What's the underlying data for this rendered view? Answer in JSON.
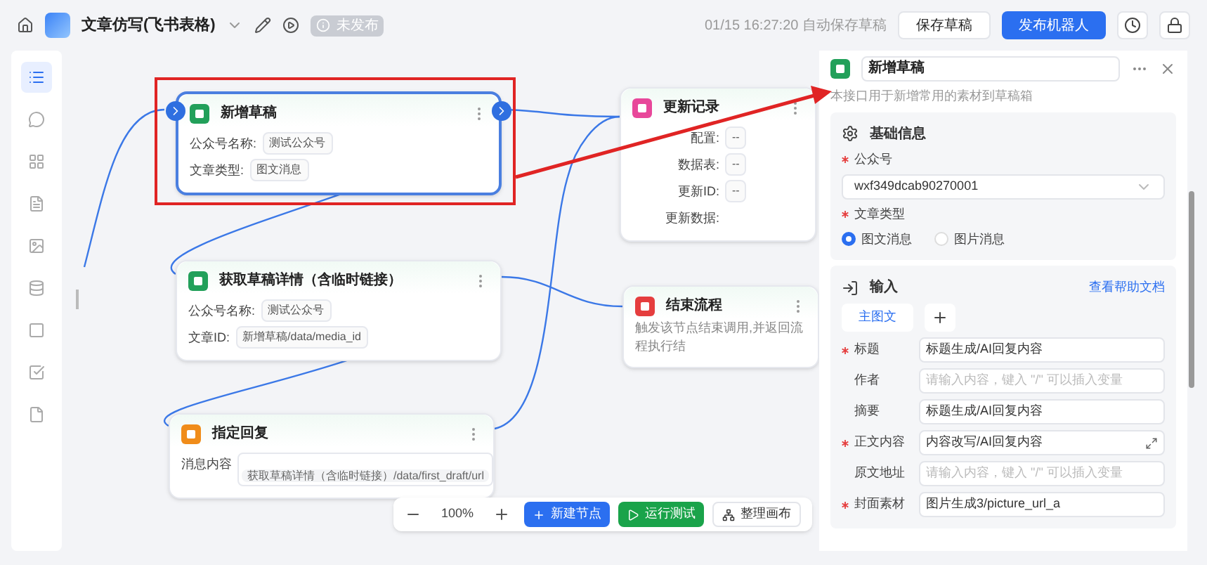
{
  "header": {
    "title": "文章仿写(飞书表格)",
    "status_badge": "未发布",
    "autosave": "01/15 16:27:20 自动保存草稿",
    "buttons": [
      {
        "label": "保存草稿",
        "kind": "secondary"
      },
      {
        "label": "发布机器人",
        "kind": "primary"
      }
    ]
  },
  "sidebar": {
    "items": [
      {
        "selected": true
      },
      {
        "selected": false
      },
      {
        "selected": false
      },
      {
        "selected": false
      },
      {
        "selected": false
      },
      {
        "selected": false
      },
      {
        "selected": false
      },
      {
        "selected": false
      },
      {
        "selected": false
      }
    ]
  },
  "nodes": [
    {
      "title": "新增草稿",
      "color": "#22a05a",
      "selected": true,
      "fields": [
        {
          "label": "公众号名称:",
          "value": "测试公众号"
        },
        {
          "label": "文章类型:",
          "value": "图文消息"
        }
      ]
    },
    {
      "title": "更新记录",
      "color": "#e8479a",
      "selected": false,
      "fields": [
        {
          "label": "配置:",
          "value": "--"
        },
        {
          "label": "数据表:",
          "value": "--"
        },
        {
          "label": "更新ID:",
          "value": "--"
        },
        {
          "label": "更新数据:"
        }
      ]
    },
    {
      "title": "获取草稿详情（含临时链接）",
      "color": "#22a05a",
      "selected": false,
      "fields": [
        {
          "label": "公众号名称:",
          "value": "测试公众号"
        },
        {
          "label": "文章ID:",
          "value": "新增草稿/data/media_id"
        }
      ]
    },
    {
      "title": "结束流程",
      "color": "#e53e3e",
      "selected": false,
      "description": "触发该节点结束调用,并返回流程执行结"
    },
    {
      "title": "指定回复",
      "color": "#f08c1a",
      "selected": false,
      "fields": [
        {
          "label": "消息内容",
          "value": "获取草稿详情（含临时链接）/data/first_draft/url",
          "kind": "box"
        }
      ]
    }
  ],
  "toolbar": {
    "zoom": "100%",
    "buttons": [
      {
        "label": "新建节点",
        "kind": "add"
      },
      {
        "label": "运行测试",
        "kind": "run"
      },
      {
        "label": "整理画布",
        "kind": "arrange"
      }
    ]
  },
  "panel": {
    "title": "新增草稿",
    "description": "本接口用于新增常用的素材到草稿箱",
    "basic": {
      "heading": "基础信息",
      "account_label": "公众号",
      "account_required": true,
      "type_required": true,
      "account_value": "wxf349dcab90270001",
      "type_label": "文章类型",
      "options": [
        {
          "label": "图文消息",
          "selected": true
        },
        {
          "label": "图片消息",
          "selected": false
        }
      ]
    },
    "input": {
      "heading": "输入",
      "help_link": "查看帮助文档",
      "tabs": [
        {
          "label": "主图文",
          "selected": true
        }
      ],
      "fields": [
        {
          "label": "标题",
          "required": true,
          "value": "标题生成/AI回复内容"
        },
        {
          "label": "作者",
          "required": false,
          "placeholder": "请输入内容，键入 \"/\" 可以插入变量"
        },
        {
          "label": "摘要",
          "required": false,
          "value": "标题生成/AI回复内容"
        },
        {
          "label": "正文内容",
          "required": true,
          "value": "内容改写/AI回复内容",
          "expandable": true
        },
        {
          "label": "原文地址",
          "required": false,
          "placeholder": "请输入内容，键入 \"/\" 可以插入变量"
        },
        {
          "label": "封面素材",
          "required": true,
          "value": "图片生成3/picture_url_a"
        }
      ]
    }
  }
}
